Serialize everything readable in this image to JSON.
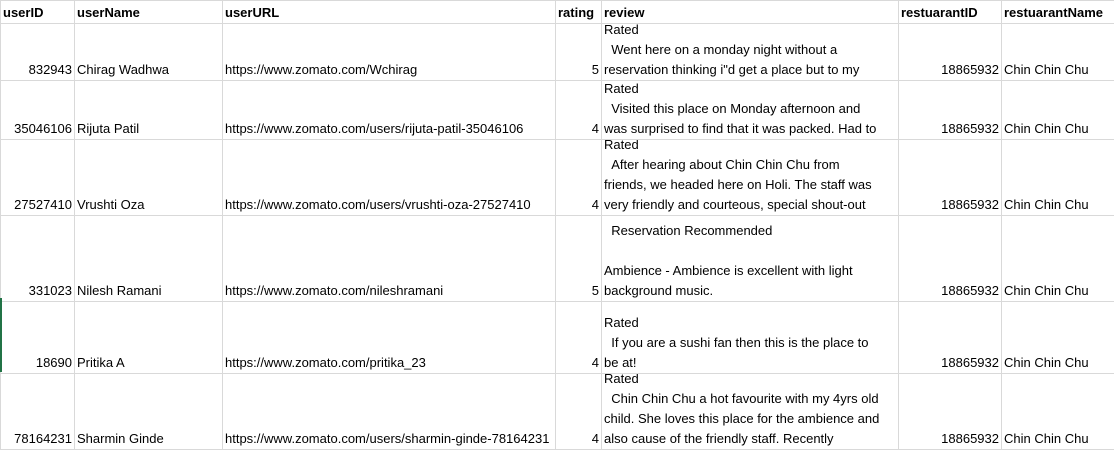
{
  "sheet": {
    "headers": {
      "userID": "userID",
      "userName": "userName",
      "userURL": "userURL",
      "rating": "rating",
      "review": "review",
      "restaurantID": "restuarantID",
      "restaurantName": "restuarantName"
    },
    "rows": [
      {
        "userID": "832943",
        "userName": "Chirag Wadhwa",
        "userURL": "https://www.zomato.com/Wchirag",
        "rating": "5",
        "review": "Rated\n  Went here on a monday night without a\nreservation thinking i\"d get a place but to my",
        "restaurantID": "18865932",
        "restaurantName": "Chin Chin Chu"
      },
      {
        "userID": "35046106",
        "userName": "Rijuta Patil",
        "userURL": "https://www.zomato.com/users/rijuta-patil-35046106",
        "rating": "4",
        "review": "Rated\n  Visited this place on Monday afternoon and\nwas surprised to find that it was packed. Had to",
        "restaurantID": "18865932",
        "restaurantName": "Chin Chin Chu"
      },
      {
        "userID": "27527410",
        "userName": "Vrushti Oza",
        "userURL": "https://www.zomato.com/users/vrushti-oza-27527410",
        "rating": "4",
        "review": "Rated\n  After hearing about Chin Chin Chu from\nfriends, we headed here on Holi. The staff was\nvery friendly and courteous, special shout-out",
        "restaurantID": "18865932",
        "restaurantName": "Chin Chin Chu"
      },
      {
        "userID": "331023",
        "userName": "Nilesh Ramani",
        "userURL": "https://www.zomato.com/nileshramani",
        "rating": "5",
        "review": "  Reservation Recommended\n\nAmbience - Ambience is excellent with light\nbackground music.",
        "restaurantID": "18865932",
        "restaurantName": "Chin Chin Chu"
      },
      {
        "userID": "18690",
        "userName": "Pritika A",
        "userURL": "https://www.zomato.com/pritika_23",
        "rating": "4",
        "review": "Rated\n  If you are a sushi fan then this is the place to\nbe at!",
        "restaurantID": "18865932",
        "restaurantName": "Chin Chin Chu"
      },
      {
        "userID": "78164231",
        "userName": "Sharmin Ginde",
        "userURL": "https://www.zomato.com/users/sharmin-ginde-78164231",
        "rating": "4",
        "review": "Rated\n  Chin Chin Chu a hot favourite with my 4yrs old\nchild. She loves this place for the ambience and\nalso cause of the friendly staff. Recently",
        "restaurantID": "18865932",
        "restaurantName": "Chin Chin Chu"
      }
    ]
  },
  "colors": {
    "gridline": "#d9d9d9",
    "selection_marker": "#217346"
  }
}
